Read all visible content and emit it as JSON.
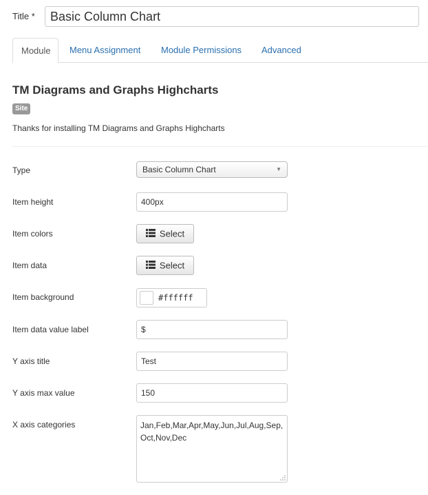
{
  "title_field": {
    "label": "Title *",
    "value": "Basic Column Chart"
  },
  "tabs": [
    {
      "label": "Module",
      "active": true
    },
    {
      "label": "Menu Assignment",
      "active": false
    },
    {
      "label": "Module Permissions",
      "active": false
    },
    {
      "label": "Advanced",
      "active": false
    }
  ],
  "module": {
    "title": "TM Diagrams and Graphs Highcharts",
    "badge": "Site",
    "description": "Thanks for installing TM Diagrams and Graphs Highcharts"
  },
  "fields": {
    "type": {
      "label": "Type",
      "value": "Basic Column Chart"
    },
    "item_height": {
      "label": "Item height",
      "value": "400px"
    },
    "item_colors": {
      "label": "Item colors",
      "button": "Select"
    },
    "item_data": {
      "label": "Item data",
      "button": "Select"
    },
    "item_background": {
      "label": "Item background",
      "value": "#ffffff",
      "swatch_color": "#ffffff"
    },
    "item_data_value_label": {
      "label": "Item data value label",
      "value": "$"
    },
    "y_axis_title": {
      "label": "Y axis title",
      "value": "Test"
    },
    "y_axis_max_value": {
      "label": "Y axis max value",
      "value": "150"
    },
    "x_axis_categories": {
      "label": "X axis categories",
      "value": "Jan,Feb,Mar,Apr,May,Jun,Jul,Aug,Sep,Oct,Nov,Dec"
    }
  },
  "colors": {
    "link": "#2a6fae",
    "badge": "#999999",
    "border": "#cccccc"
  }
}
